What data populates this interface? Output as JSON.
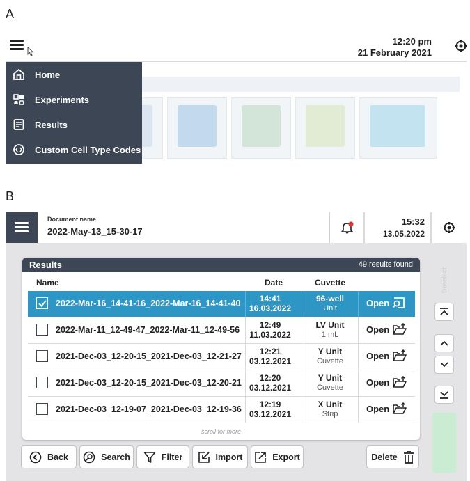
{
  "labels": {
    "panel_a": "A",
    "panel_b": "B"
  },
  "panel_a": {
    "time": "12:20 pm",
    "date": "21 February 2021",
    "menu": [
      {
        "label": "Home",
        "icon": "home-icon"
      },
      {
        "label": "Experiments",
        "icon": "experiments-icon"
      },
      {
        "label": "Results",
        "icon": "results-icon"
      },
      {
        "label": "Custom Cell Type Codes",
        "icon": "cell-type-codes-icon"
      }
    ]
  },
  "panel_b": {
    "doc_label": "Document name",
    "doc_name": "2022-May-13_15-30-17",
    "time": "15:32",
    "date": "13.05.2022",
    "results": {
      "title": "Results",
      "count": "49 results found",
      "columns": {
        "name": "Name",
        "date": "Date",
        "cuvette": "Cuvette"
      },
      "open_label": "Open",
      "rows": [
        {
          "name": "2022-Mar-16_14-41-16_2022-Mar-16_14-41-40",
          "time": "14:41",
          "date": "16.03.2022",
          "cuvette": "96-well",
          "cuvette_sub": "Unit",
          "selected": true
        },
        {
          "name": "2022-Mar-11_12-49-47_2022-Mar-11_12-49-56",
          "time": "12:49",
          "date": "11.03.2022",
          "cuvette": "LV Unit",
          "cuvette_sub": "1 mL",
          "selected": false
        },
        {
          "name": "2021-Dec-03_12-20-15_2021-Dec-03_12-21-27",
          "time": "12:21",
          "date": "03.12.2021",
          "cuvette": "Y Unit",
          "cuvette_sub": "Cuvette",
          "selected": false
        },
        {
          "name": "2021-Dec-03_12-20-15_2021-Dec-03_12-20-21",
          "time": "12:20",
          "date": "03.12.2021",
          "cuvette": "Y Unit",
          "cuvette_sub": "Cuvette",
          "selected": false
        },
        {
          "name": "2021-Dec-03_12-19-07_2021-Dec-03_12-19-36",
          "time": "12:19",
          "date": "03.12.2021",
          "cuvette": "X Unit",
          "cuvette_sub": "Strip",
          "selected": false
        }
      ],
      "scroll_hint": "scroll for more"
    },
    "deselect": "Deselect",
    "buttons": {
      "back": "Back",
      "search": "Search",
      "filter": "Filter",
      "import": "Import",
      "export": "Export",
      "delete": "Delete"
    },
    "colors": {
      "accent": "#2d96c4",
      "dark": "#3d4654",
      "alert": "#e8333a"
    }
  }
}
